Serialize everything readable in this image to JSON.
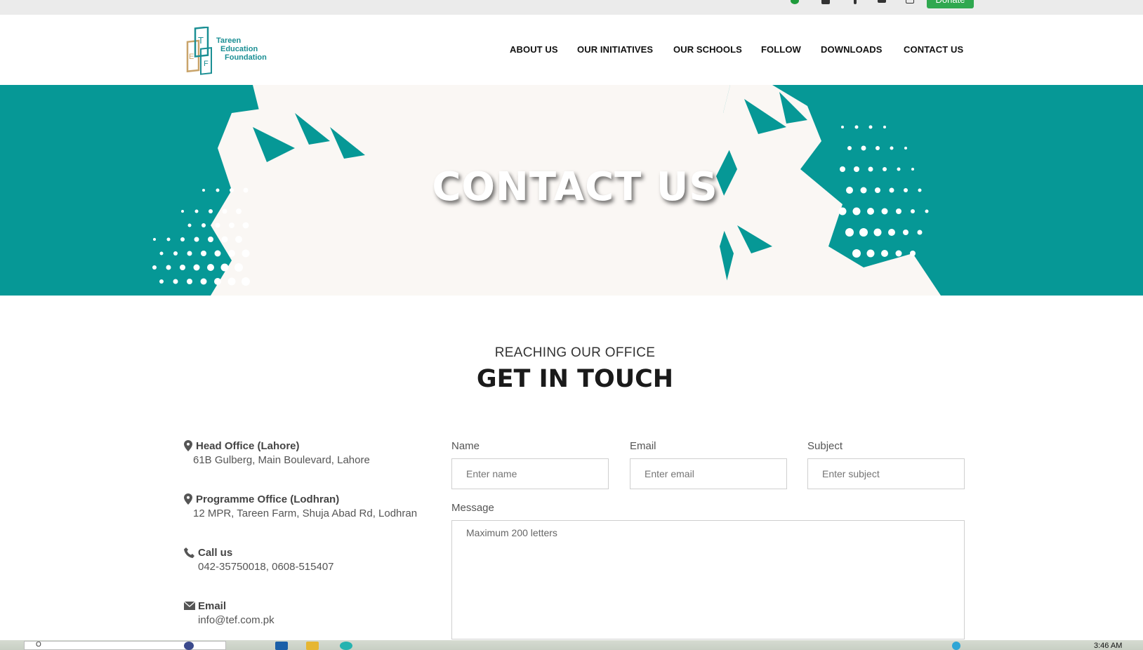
{
  "top_bar": {
    "icons": [
      "whatsapp-icon",
      "instagram-icon",
      "facebook-icon",
      "twitter-icon",
      "youtube-icon"
    ],
    "donate_label": "Donate"
  },
  "header": {
    "logo": {
      "line1": "Tareen",
      "line2": "Education",
      "line3": "Foundation",
      "letters": [
        "T",
        "E",
        "F"
      ]
    },
    "nav": [
      "ABOUT US",
      "OUR INITIATIVES",
      "OUR SCHOOLS",
      "FOLLOW",
      "DOWNLOADS",
      "CONTACT US"
    ]
  },
  "banner": {
    "title": "CONTACT US"
  },
  "section": {
    "eyebrow": "REACHING OUR OFFICE",
    "heading": "GET IN TOUCH"
  },
  "contact_info": [
    {
      "icon": "map-marker-icon",
      "title": "Head Office (Lahore)",
      "text": "61B Gulberg, Main Boulevard, Lahore"
    },
    {
      "icon": "map-marker-icon",
      "title": "Programme Office (Lodhran)",
      "text": "12 MPR, Tareen Farm, Shuja Abad Rd, Lodhran"
    },
    {
      "icon": "phone-icon",
      "title": "Call us",
      "text": "042-35750018, 0608-515407"
    },
    {
      "icon": "envelope-icon",
      "title": "Email",
      "text": "info@tef.com.pk"
    }
  ],
  "form": {
    "name": {
      "label": "Name",
      "placeholder": "Enter name"
    },
    "email": {
      "label": "Email",
      "placeholder": "Enter email"
    },
    "subject": {
      "label": "Subject",
      "placeholder": "Enter subject"
    },
    "message": {
      "label": "Message",
      "placeholder": "Maximum 200 letters"
    }
  },
  "taskbar": {
    "search_text": "O",
    "clock": "3:46 AM"
  },
  "colors": {
    "teal": "#069896",
    "cream": "#faf7f4",
    "donate_green": "#2fa84f",
    "nav_text": "#111111"
  }
}
